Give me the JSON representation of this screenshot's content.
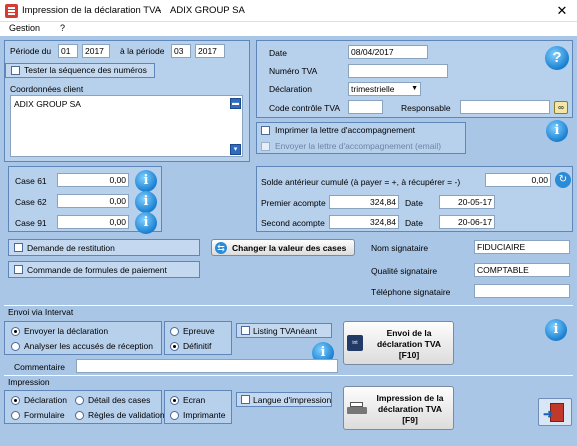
{
  "window": {
    "title": "Impression de la déclaration TVA",
    "separator": "-",
    "company": "ADIX GROUP SA",
    "close": "✕"
  },
  "menu": {
    "items": [
      {
        "label": "Gestion"
      },
      {
        "label": "?"
      }
    ]
  },
  "periode": {
    "label_from": "Période du",
    "from_month": "01",
    "from_year": "2017",
    "label_to": "à la période",
    "to_month": "03",
    "to_year": "2017",
    "tester_label": "Tester la séquence des numéros"
  },
  "coordonnees": {
    "label": "Coordonnées client",
    "value": "ADIX GROUP SA"
  },
  "right_form": {
    "date_label": "Date",
    "date_value": "08/04/2017",
    "numero_label": "Numéro TVA",
    "numero_value": "",
    "declaration_label": "Déclaration",
    "declaration_value": "trimestrielle",
    "code_label": "Code contrôle TVA",
    "code_value": "",
    "responsable_label": "Responsable",
    "responsable_value": ""
  },
  "lettre": {
    "imprimer_label": "Imprimer la lettre d'accompagnement",
    "envoyer_label": "Envoyer la lettre d'accompagnement (email)"
  },
  "cases": [
    {
      "label": "Case 61",
      "value": "0,00"
    },
    {
      "label": "Case 62",
      "value": "0,00"
    },
    {
      "label": "Case 91",
      "value": "0,00"
    }
  ],
  "solde": {
    "label": "Solde antérieur cumulé (à payer = +, à récupérer = -)",
    "value": "0,00",
    "premier_label": "Premier acompte",
    "premier_value": "324,84",
    "premier_date_label": "Date",
    "premier_date": "20-05-17",
    "second_label": "Second acompte",
    "second_value": "324,84",
    "second_date_label": "Date",
    "second_date": "20-06-17"
  },
  "restitution": {
    "demande_label": "Demande de restitution",
    "commande_label": "Commande  de formules de paiement",
    "changer_label": "Changer la valeur des cases"
  },
  "signataire": {
    "nom_label": "Nom signataire",
    "nom_value": "FIDUCIAIRE",
    "qualite_label": "Qualité signataire",
    "qualite_value": "COMPTABLE",
    "telephone_label": "Téléphone signataire",
    "telephone_value": ""
  },
  "intervat": {
    "section_label": "Envoi via Intervat",
    "envoyer_label": "Envoyer la déclaration",
    "analyser_label": "Analyser les accusés de réception",
    "epreuve_label": "Epreuve",
    "definitif_label": "Définitif",
    "listing_label": "Listing TVAnéant",
    "button_line1": "Envoi de la",
    "button_line2": "déclaration TVA",
    "button_line3": "[F10]",
    "commentaire_label": "Commentaire",
    "commentaire_value": ""
  },
  "impression": {
    "section_label": "Impression",
    "declaration_label": "Déclaration",
    "detail_label": "Détail des cases",
    "formulaire_label": "Formulaire",
    "regles_label": "Règles de validation",
    "ecran_label": "Ecran",
    "imprimante_label": "Imprimante",
    "langue_label": "Langue d'impression",
    "button_line1": "Impression de la",
    "button_line2": "déclaration TVA",
    "button_line3": "[F9]"
  },
  "icons": {
    "info": "i",
    "help": "?"
  },
  "colors": {
    "background": "#aac6e6",
    "panel": "#b7d0ec",
    "border": "#5f86b9",
    "accent": "#1a7fd1"
  }
}
